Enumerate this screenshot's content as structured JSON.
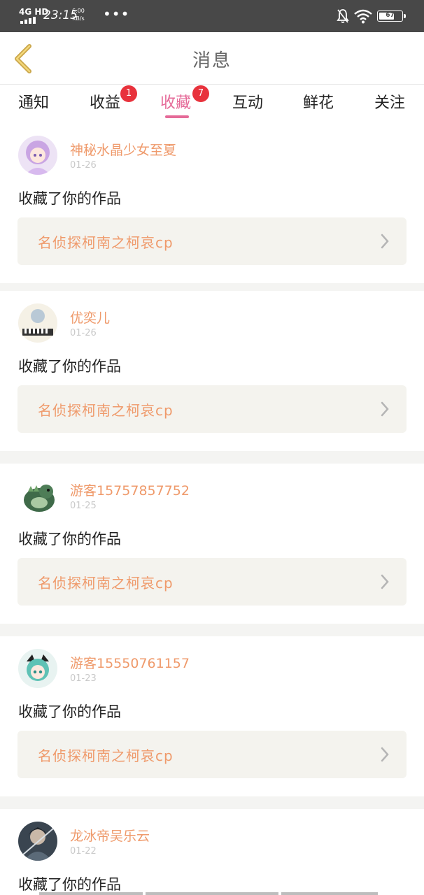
{
  "status_bar": {
    "network": "4G HD",
    "time": "23:15",
    "speed_value": "6.00",
    "speed_unit": "KB/s",
    "more": "•••",
    "battery": "67"
  },
  "header": {
    "title": "消息",
    "back_icon": "chevron-left-icon"
  },
  "tabs": [
    {
      "label": "通知",
      "badge": ""
    },
    {
      "label": "收益",
      "badge": "1"
    },
    {
      "label": "收藏",
      "badge": "7",
      "active": true
    },
    {
      "label": "互动",
      "badge": ""
    },
    {
      "label": "鲜花",
      "badge": ""
    },
    {
      "label": "关注",
      "badge": ""
    }
  ],
  "items": [
    {
      "user": "神秘水晶少女至夏",
      "time": "01-26",
      "action": "收藏了你的作品",
      "work": "名侦探柯南之柯哀cp"
    },
    {
      "user": "优奕儿",
      "time": "01-26",
      "action": "收藏了你的作品",
      "work": "名侦探柯南之柯哀cp"
    },
    {
      "user": "游客15757857752",
      "time": "01-25",
      "action": "收藏了你的作品",
      "work": "名侦探柯南之柯哀cp"
    },
    {
      "user": "游客15550761157",
      "time": "01-23",
      "action": "收藏了你的作品",
      "work": "名侦探柯南之柯哀cp"
    },
    {
      "user": "龙冰帝吴乐云",
      "time": "01-22",
      "action": "收藏了你的作品",
      "work": ""
    }
  ],
  "colors": {
    "accent": "#e56a98",
    "username": "#ef9a6b",
    "badge": "#e8323c",
    "status_bar": "#484848"
  }
}
